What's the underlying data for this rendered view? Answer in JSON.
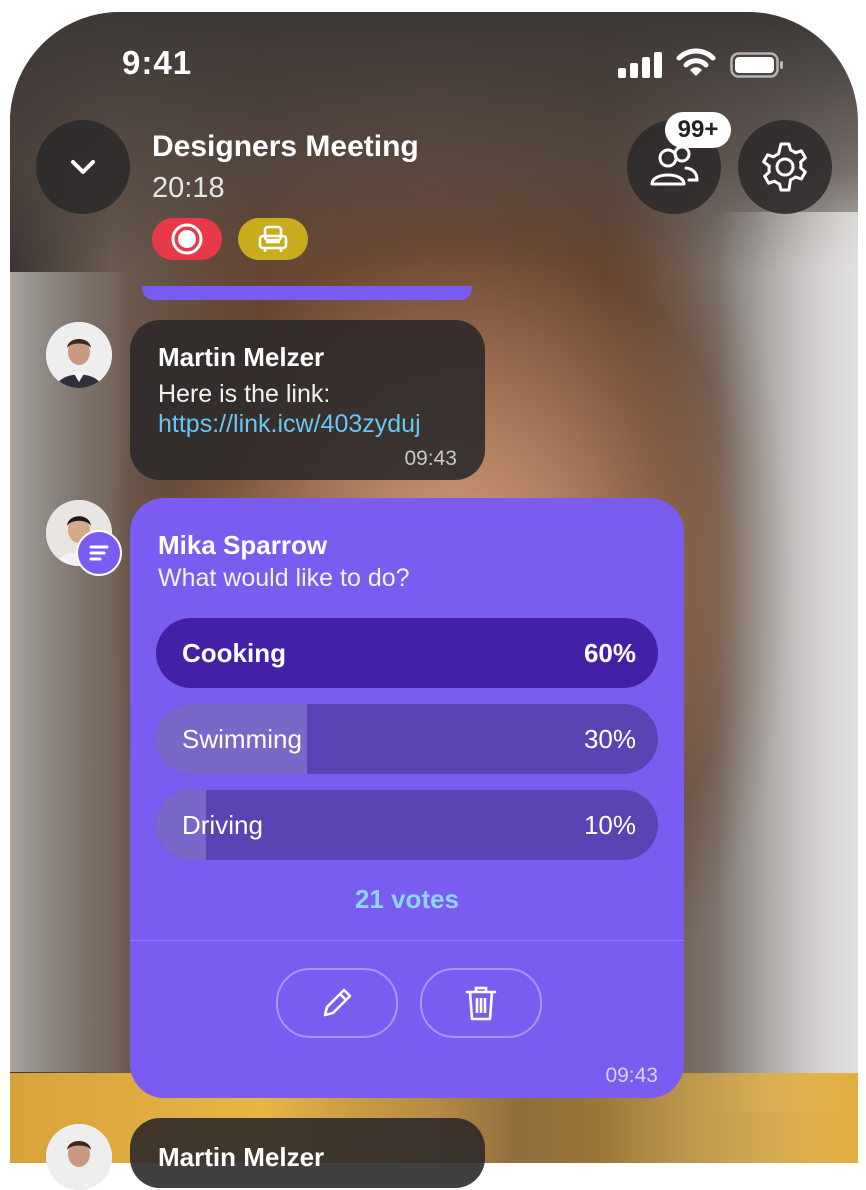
{
  "status_bar": {
    "time": "9:41"
  },
  "header": {
    "title": "Designers Meeting",
    "elapsed": "20:18",
    "participants_badge": "99+"
  },
  "messages": [
    {
      "sender": "Martin Melzer",
      "text": "Here is the link:",
      "link": "https://link.icw/403zyduj",
      "time": "09:43"
    }
  ],
  "poll": {
    "sender": "Mika Sparrow",
    "question": "What would like to do?",
    "options": [
      {
        "label": "Cooking",
        "percent": "60%",
        "value": 60
      },
      {
        "label": "Swimming",
        "percent": "30%",
        "value": 30
      },
      {
        "label": "Driving",
        "percent": "10%",
        "value": 10
      }
    ],
    "votes": "21 votes",
    "time": "09:43"
  },
  "partial_message": {
    "sender": "Martin Melzer"
  },
  "colors": {
    "accent": "#7b5cf0",
    "record": "#e8394a",
    "seat": "#c9ad1e",
    "link": "#68c7f2"
  }
}
